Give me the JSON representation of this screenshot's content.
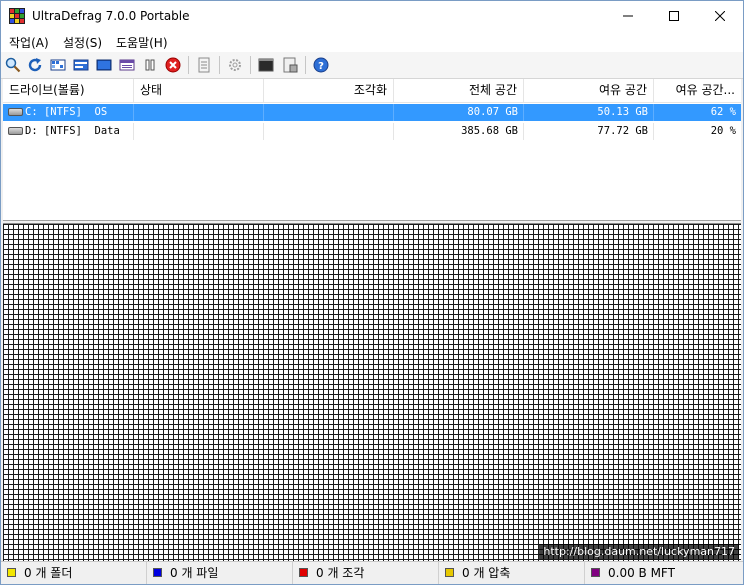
{
  "window": {
    "title": "UltraDefrag 7.0.0 Portable"
  },
  "menu": [
    {
      "label": "작업(A)"
    },
    {
      "label": "설정(S)"
    },
    {
      "label": "도움말(H)"
    }
  ],
  "toolbar": {
    "icons": [
      "search-icon",
      "refresh-icon",
      "defrag-icon",
      "quick-optimize-icon",
      "full-optimize-icon",
      "mft-optimize-icon",
      "pause-icon",
      "stop-icon",
      "report-icon",
      "settings-icon",
      "terminal-icon",
      "boot-script-icon",
      "help-icon"
    ]
  },
  "columns": [
    {
      "label": "드라이브(볼륨)"
    },
    {
      "label": "상태"
    },
    {
      "label": "조각화"
    },
    {
      "label": "전체 공간"
    },
    {
      "label": "여유 공간"
    },
    {
      "label": "여유 공간..."
    }
  ],
  "drives": [
    {
      "volume": "C: [NTFS]  OS",
      "status": "",
      "fragmentation": "",
      "total": "80.07 GB",
      "free": "50.13 GB",
      "free_pct": "62 %",
      "selected": true
    },
    {
      "volume": "D: [NTFS]  Data",
      "status": "",
      "fragmentation": "",
      "total": "385.68 GB",
      "free": "77.72 GB",
      "free_pct": "20 %",
      "selected": false
    }
  ],
  "watermark": "http://blog.daum.net/luckyman717",
  "status": [
    {
      "label": "0 개 폴더",
      "color": "#f2e600"
    },
    {
      "label": "0 개 파일",
      "color": "#0000e0"
    },
    {
      "label": "0 개 조각",
      "color": "#e00000"
    },
    {
      "label": "0 개 압축",
      "color": "#e6c800"
    },
    {
      "label": "0.00 B MFT",
      "color": "#800080"
    }
  ]
}
